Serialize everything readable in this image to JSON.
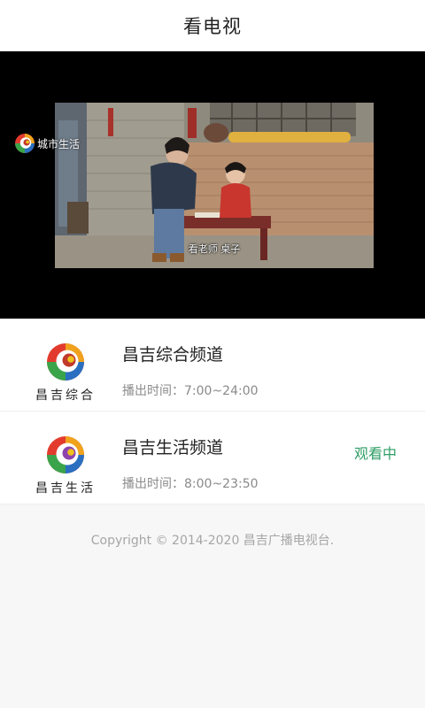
{
  "header": {
    "title": "看电视"
  },
  "player": {
    "watermark": "城市生活",
    "subtitle": "看老师 桌子"
  },
  "channels": [
    {
      "name": "昌吉综合频道",
      "logo_caption": "昌吉综合",
      "time": "播出时间：7:00~24:00",
      "status": ""
    },
    {
      "name": "昌吉生活频道",
      "logo_caption": "昌吉生活",
      "time": "播出时间：8:00~23:50",
      "status": "观看中"
    }
  ],
  "footer": {
    "copyright": "Copyright © 2014-2020 昌吉广播电视台."
  },
  "colors": {
    "accent": "#2f9d66",
    "logo_red": "#e23b2e",
    "logo_orange": "#f0a21d",
    "logo_green": "#3aa44a",
    "logo_blue": "#2a6fc0"
  }
}
